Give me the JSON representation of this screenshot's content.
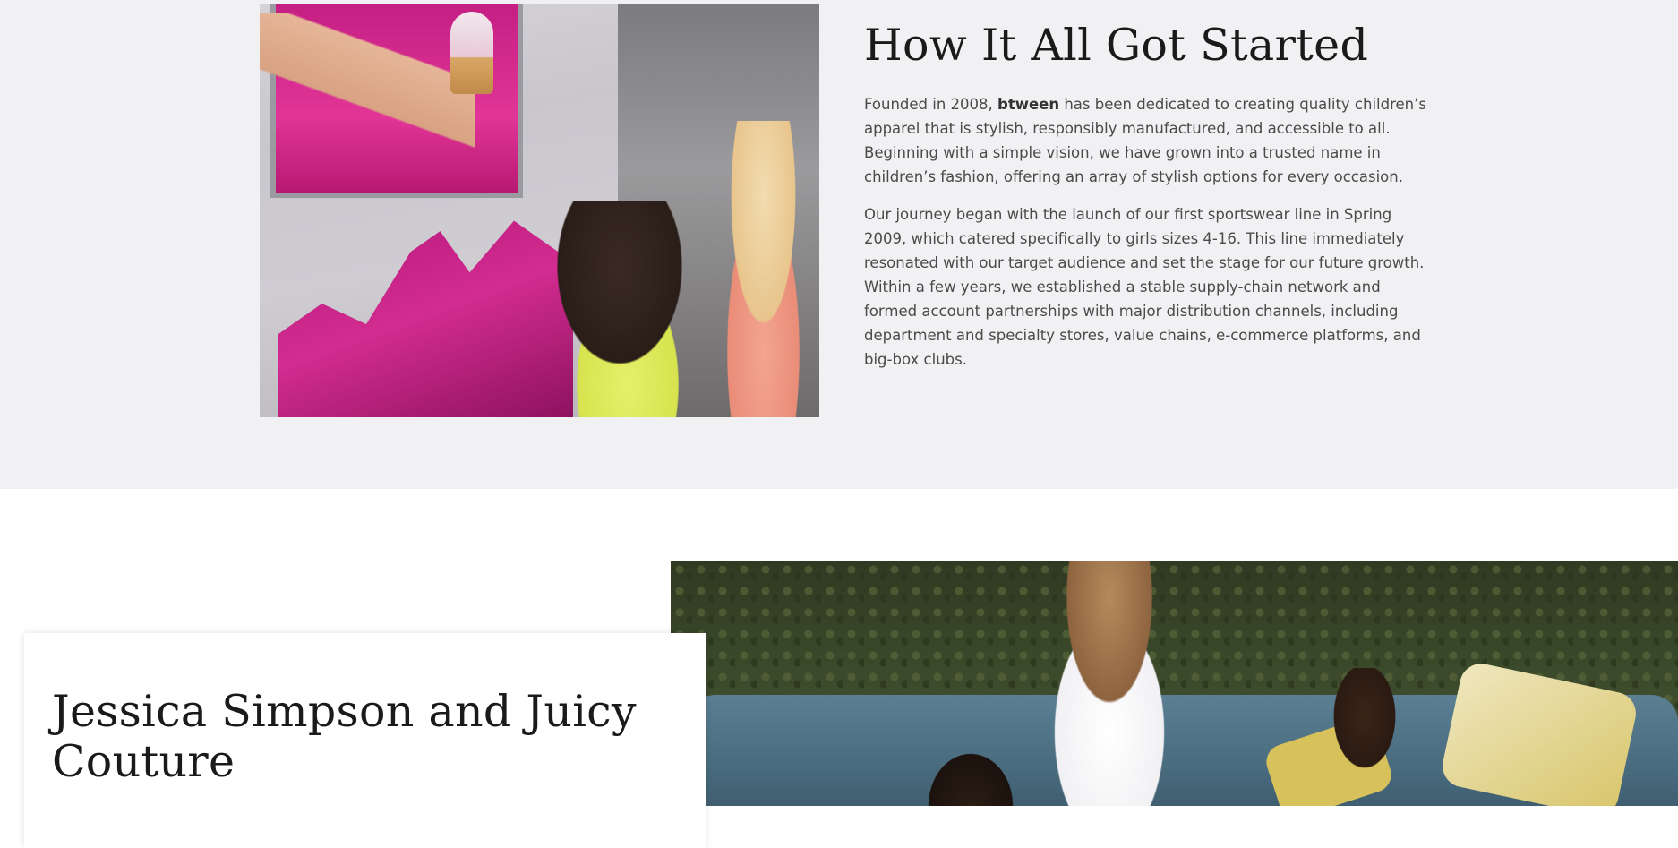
{
  "story": {
    "title": "How It All Got Started",
    "paragraph1_before_brand": "Founded in 2008, ",
    "brand": "btween",
    "paragraph1_after_brand": " has been dedicated to creating quality children’s apparel that is stylish, responsibly manufactured, and accessible to all. Beginning with a simple vision, we have grown into a trusted name in children’s fashion, offering an array of stylish options for every occasion.",
    "paragraph2": "Our journey began with the launch of our first sportswear line in Spring 2009, which catered specifically to girls sizes 4-16. This line immediately resonated with our target audience and set the stage for our future growth. Within a few years, we established a stable supply-chain network and formed account partnerships with major distribution channels, including department and specialty stores, value chains, e-commerce platforms, and big-box clubs."
  },
  "licensing": {
    "title": "Jessica Simpson and Juicy Couture"
  },
  "colors": {
    "section_bg": "#f1f0f3",
    "page_bg": "#ffffff",
    "heading": "#1a1a1a",
    "body_text": "#4a4a4a"
  }
}
